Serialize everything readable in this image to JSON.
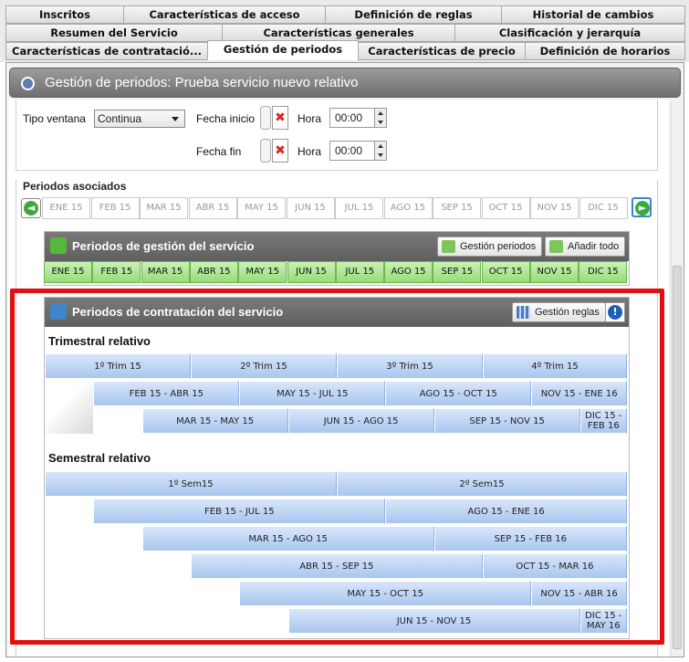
{
  "tabs": {
    "row1": [
      "Inscritos",
      "Características de acceso",
      "Definición de reglas",
      "Historial de cambios"
    ],
    "row2": [
      "Resumen del Servicio",
      "Características generales",
      "Clasificación y jerarquía"
    ],
    "row3": [
      "Características de contratació...",
      "Gestión de periodos",
      "Características de precio",
      "Definición de horarios"
    ],
    "active": "Gestión de periodos"
  },
  "window": {
    "title": "Gestión de periodos: Prueba servicio nuevo relativo"
  },
  "form": {
    "tipo_ventana_label": "Tipo ventana",
    "tipo_ventana_value": "Continua",
    "fecha_inicio_label": "Fecha inicio",
    "fecha_fin_label": "Fecha fin",
    "hora_label": "Hora",
    "hora_inicio_value": "00:00",
    "hora_fin_value": "00:00"
  },
  "periodos_asociados": {
    "label": "Periodos asociados",
    "months": [
      "ENE 15",
      "FEB 15",
      "MAR 15",
      "ABR 15",
      "MAY 15",
      "JUN 15",
      "JUL 15",
      "AGO 15",
      "SEP 15",
      "OCT 15",
      "NOV 15",
      "DIC 15"
    ]
  },
  "gestion_panel": {
    "title": "Periodos de gestión del servicio",
    "btn_gestion": "Gestión periodos",
    "btn_anadir": "Añadir todo",
    "months": [
      "ENE 15",
      "FEB 15",
      "MAR 15",
      "ABR 15",
      "MAY 15",
      "JUN 15",
      "JUL 15",
      "AGO 15",
      "SEP 15",
      "OCT 15",
      "NOV 15",
      "DIC 15"
    ]
  },
  "contratacion_panel": {
    "title": "Periodos de contratación del servicio",
    "btn_reglas": "Gestión reglas",
    "trimestral": {
      "title": "Trimestral relativo",
      "rows": [
        [
          "1º Trim 15",
          "2º Trim 15",
          "3º Trim 15",
          "4º Trim 15"
        ],
        [
          "FEB 15 - ABR 15",
          "MAY 15 - JUL 15",
          "AGO 15 - OCT 15",
          "NOV 15 - ENE 16"
        ],
        [
          "MAR 15 - MAY 15",
          "JUN 15 - AGO 15",
          "SEP 15 - NOV 15",
          "DIC 15 - FEB 16"
        ]
      ]
    },
    "semestral": {
      "title": "Semestral relativo",
      "rows": [
        [
          "1º Sem15",
          "2º Sem15"
        ],
        [
          "FEB 15 - JUL 15",
          "AGO 15 - ENE 16"
        ],
        [
          "MAR 15 - AGO 15",
          "SEP 15 - FEB 16"
        ],
        [
          "ABR 15 - SEP 15",
          "OCT 15 - MAR 16"
        ],
        [
          "MAY 15 - OCT 15",
          "NOV 15 - ABR 16"
        ],
        [
          "JUN 15 - NOV 15",
          "DIC 15 - MAY 16"
        ]
      ]
    }
  },
  "colors": {
    "highlight": "#e01010",
    "green_period": "#97dc78",
    "blue_bar": "#a9c6ee"
  }
}
